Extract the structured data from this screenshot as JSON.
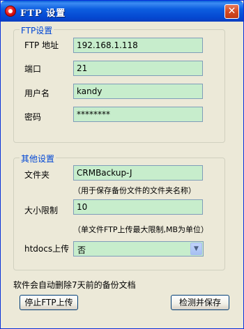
{
  "window": {
    "title": "FTP  设置",
    "close_label": "✕"
  },
  "ftp_group": {
    "title": "FTP设置",
    "fields": [
      {
        "label": "FTP 地址",
        "value": "192.168.1.118"
      },
      {
        "label": "端口",
        "value": "21"
      },
      {
        "label": "用户名",
        "value": "kandy"
      },
      {
        "label": "密码",
        "value": "********"
      }
    ]
  },
  "other_group": {
    "title": "其他设置",
    "folder_label": "文件夹",
    "folder_value": "CRMBackup-J",
    "folder_hint": "（用于保存备份文件的文件夹名称）",
    "size_label": "大小限制",
    "size_value": "10",
    "size_hint": "（单文件FTP上传最大限制,MB为单位）",
    "htdocs_label": "htdocs上传",
    "htdocs_value": "否"
  },
  "note": "软件会自动删除7天前的备份文档",
  "buttons": {
    "stop": "停止FTP上传",
    "save": "检测并保存"
  }
}
